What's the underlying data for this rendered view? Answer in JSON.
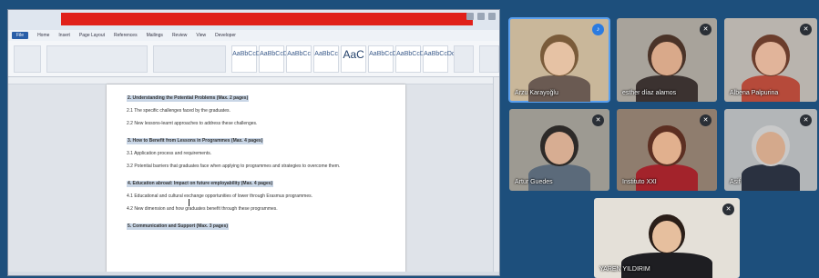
{
  "word": {
    "tabs": [
      "Home",
      "Insert",
      "Page Layout",
      "References",
      "Mailings",
      "Review",
      "View",
      "Developer"
    ],
    "file_tab": "File",
    "styles": [
      {
        "label": "AaBbCcDc",
        "big": false
      },
      {
        "label": "AaBbCcDc",
        "big": false
      },
      {
        "label": "AaBbCc",
        "big": false
      },
      {
        "label": "AaBbCc",
        "big": false
      },
      {
        "label": "AaC",
        "big": true
      },
      {
        "label": "AaBbCcDc",
        "big": false
      },
      {
        "label": "AaBbCcDc",
        "big": false
      },
      {
        "label": "AaBbCcDc",
        "big": false
      }
    ],
    "doc": [
      {
        "type": "sec",
        "text": "2. Understanding the Potential Problems (Max. 2 pages)"
      },
      {
        "type": "item",
        "text": "2.1 The specific challenges faced by the graduates."
      },
      {
        "type": "item",
        "text": "2.2 New lessons-learnt approaches to address these challenges."
      },
      {
        "type": "sec",
        "text": "3. How to Benefit from Lessons in Programmes (Max. 4 pages)"
      },
      {
        "type": "item",
        "text": "3.1 Application process and requirements."
      },
      {
        "type": "item",
        "text": "3.2 Potential barriers that graduates face when applying to programmes and strategies to overcome them."
      },
      {
        "type": "sec",
        "text": "4. Education abroad: Impact on future employability (Max. 4 pages)"
      },
      {
        "type": "item",
        "text": "4.1 Educational and cultural exchange opportunities of lower through Erasmus programmes."
      },
      {
        "type": "item",
        "text": "4.2 New dimension and how graduates benefit through these programmes."
      },
      {
        "type": "sec",
        "text": "5. Communication and Support (Max. 3 pages)"
      }
    ]
  },
  "participants": [
    {
      "name": "Arzu Karayoğlu",
      "mic": "live",
      "active": true,
      "bg": "#c9b79a",
      "skin": "#e6c2a4",
      "hair": "#7a5b3a",
      "shirt": "#6a5a52"
    },
    {
      "name": "esther díaz alamos",
      "mic": "muted",
      "active": false,
      "bg": "#a8a39b",
      "skin": "#d9a98a",
      "hair": "#4a3328",
      "shirt": "#3b3230"
    },
    {
      "name": "Albena Palpurina",
      "mic": "muted",
      "active": false,
      "bg": "#b9b4ae",
      "skin": "#e1b49a",
      "hair": "#6b3d2c",
      "shirt": "#b64a3a"
    },
    {
      "name": "Artur Guedes",
      "mic": "muted",
      "active": false,
      "bg": "#9d9a92",
      "skin": "#d7ad92",
      "hair": "#2d2a28",
      "shirt": "#5b6a7a"
    },
    {
      "name": "Instituto XXI",
      "mic": "muted",
      "active": false,
      "bg": "#8f7d6e",
      "skin": "#e1b08e",
      "hair": "#5c2f22",
      "shirt": "#a3232b"
    },
    {
      "name": "Asif",
      "mic": "muted",
      "active": false,
      "bg": "#b3b6b8",
      "skin": "#d4a98c",
      "hair": "#c9c9c9",
      "shirt": "#2a3140"
    },
    {
      "name": "YAREN YILDIRIM",
      "mic": "muted",
      "active": false,
      "bg": "#e4e0d8",
      "skin": "#e6bf9e",
      "hair": "#2a1e18",
      "shirt": "#1e1e22"
    }
  ]
}
